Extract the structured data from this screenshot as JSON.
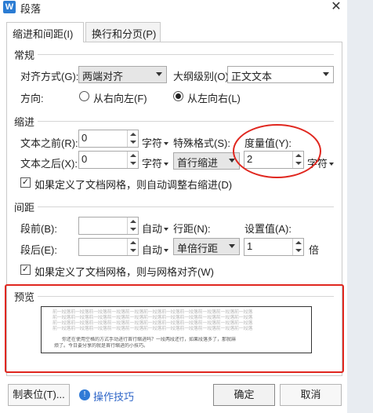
{
  "window": {
    "title": "段落",
    "app_icon_letter": "W",
    "close_glyph": "✕"
  },
  "tabs": [
    {
      "label": "缩进和间距(I)",
      "active": true
    },
    {
      "label": "换行和分页(P)",
      "active": false
    }
  ],
  "general": {
    "heading": "常规",
    "alignment": {
      "label": "对齐方式(G):",
      "value": "两端对齐"
    },
    "outline_level": {
      "label": "大纲级别(O):",
      "value": "正文文本"
    },
    "direction": {
      "label": "方向:",
      "options": [
        {
          "label": "从右向左(F)",
          "selected": false
        },
        {
          "label": "从左向右(L)",
          "selected": true
        }
      ]
    }
  },
  "indent": {
    "heading": "缩进",
    "before_text": {
      "label": "文本之前(R):",
      "value": "0",
      "unit": "字符"
    },
    "after_text": {
      "label": "文本之后(X):",
      "value": "0",
      "unit": "字符"
    },
    "special": {
      "label": "特殊格式(S):",
      "value": "首行缩进"
    },
    "measure": {
      "label": "度量值(Y):",
      "value": "2",
      "unit": "字符"
    },
    "auto_adjust": {
      "label": "如果定义了文档网格，则自动调整右缩进(D)",
      "checked": true
    }
  },
  "spacing": {
    "heading": "间距",
    "before": {
      "label": "段前(B):",
      "value": "",
      "unit": "自动"
    },
    "after": {
      "label": "段后(E):",
      "value": "",
      "unit": "自动"
    },
    "line_spacing": {
      "label": "行距(N):",
      "value": "单倍行距"
    },
    "set_value": {
      "label": "设置值(A):",
      "value": "1",
      "unit": "倍"
    },
    "snap_grid": {
      "label": "如果定义了文档网格，则与网格对齐(W)",
      "checked": true
    }
  },
  "preview": {
    "heading": "预览",
    "prev_lines": [
      "前一段落前一段落前一段落前一段落前一段落前一段落前一段落前一段落前一段落前一段落前一段落",
      "前一段落前一段落前一段落前一段落前一段落前一段落前一段落前一段落前一段落前一段落前一段落",
      "前一段落前一段落前一段落前一段落前一段落前一段落前一段落前一段落前一段落前一段落前一段落",
      "前一段落前一段落前一段落前一段落前一段落前一段落前一段落前一段落前一段落前一段落前一段落"
    ],
    "current_lines": [
      "你还在使用空格的方式手动进行首行缩进吗？一段两段还行，如果段落多了，那就麻",
      "烦了。今日要分享的就是首行缩进的小技巧。"
    ]
  },
  "footer": {
    "tabs_button": "制表位(T)...",
    "tips_link": "操作技巧",
    "ok_button": "确定",
    "cancel_button": "取消"
  },
  "colors": {
    "annotation_red": "#e0271f",
    "link_blue": "#2f66c8"
  },
  "icons": [
    "word-app-icon",
    "close-icon",
    "chevron-down-icon",
    "spin-up-icon",
    "spin-down-icon",
    "lightbulb-icon"
  ]
}
